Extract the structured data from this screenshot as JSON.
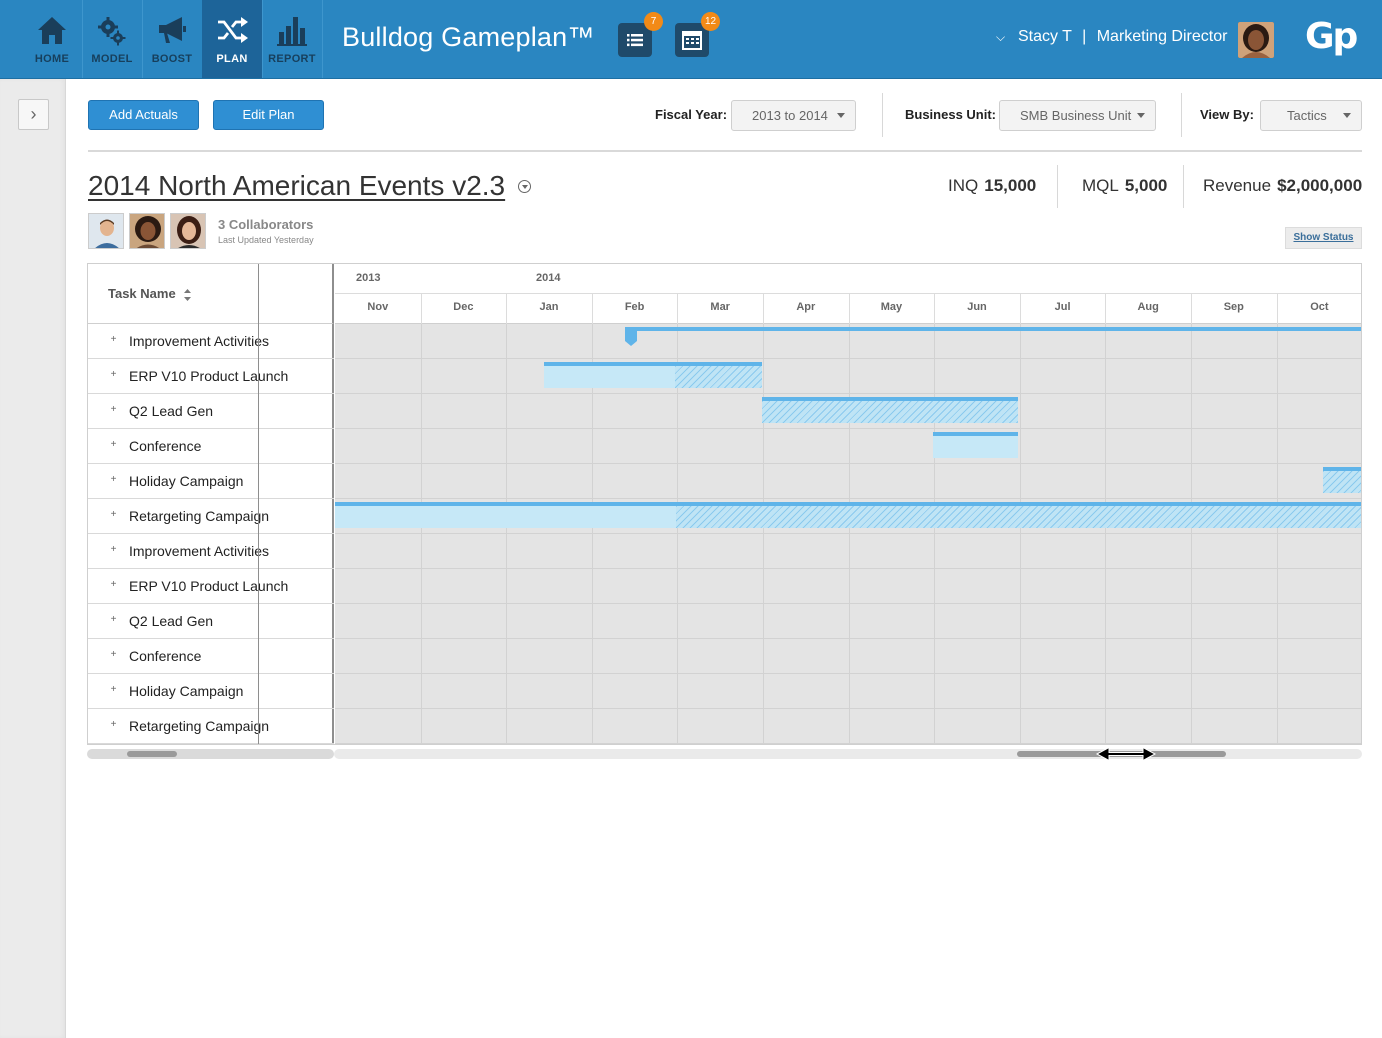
{
  "nav": {
    "items": [
      {
        "label": "HOME",
        "icon": "home-icon"
      },
      {
        "label": "MODEL",
        "icon": "gears-icon"
      },
      {
        "label": "BOOST",
        "icon": "megaphone-icon"
      },
      {
        "label": "PLAN",
        "icon": "shuffle-icon",
        "active": true
      },
      {
        "label": "REPORT",
        "icon": "bar-chart-icon"
      }
    ]
  },
  "header": {
    "app_title": "Bulldog Gameplan™",
    "list_badge": "7",
    "calendar_badge": "12",
    "user_name": "Stacy T",
    "user_separator": "|",
    "user_role": "Marketing Director",
    "logo_text": "Gp"
  },
  "toolbar": {
    "add_actuals": "Add Actuals",
    "edit_plan": "Edit Plan",
    "fiscal_year_label": "Fiscal Year:",
    "fiscal_year_value": "2013 to 2014",
    "business_unit_label": "Business Unit:",
    "business_unit_value": "SMB Business Unit",
    "view_by_label": "View By:",
    "view_by_value": "Tactics"
  },
  "plan": {
    "title": "2014 North American Events v2.3",
    "metrics": {
      "inq_label": "INQ",
      "inq_value": "15,000",
      "mql_label": "MQL",
      "mql_value": "5,000",
      "revenue_label": "Revenue",
      "revenue_value": "$2,000,000"
    },
    "collaborators_count": "3 Collaborators",
    "last_updated": "Last Updated Yesterday",
    "show_status": "Show Status"
  },
  "gantt": {
    "task_column_label": "Task Name",
    "years": [
      "2013",
      "2014"
    ],
    "months": [
      "Nov",
      "Dec",
      "Jan",
      "Feb",
      "Mar",
      "Apr",
      "May",
      "Jun",
      "Jul",
      "Aug",
      "Sep",
      "Oct"
    ],
    "tasks": [
      {
        "name": "Improvement Activities"
      },
      {
        "name": "ERP V10 Product Launch"
      },
      {
        "name": "Q2 Lead Gen"
      },
      {
        "name": "Conference"
      },
      {
        "name": "Holiday Campaign"
      },
      {
        "name": "Retargeting Campaign"
      },
      {
        "name": "Improvement Activities"
      },
      {
        "name": "ERP V10 Product Launch"
      },
      {
        "name": "Q2 Lead Gen"
      },
      {
        "name": "Conference"
      },
      {
        "name": "Holiday Campaign"
      },
      {
        "name": "Retargeting Campaign"
      }
    ]
  },
  "colors": {
    "nav_blue": "#2a86c1",
    "nav_active": "#1d6499",
    "bar_blue": "#5fb4e9",
    "bar_light": "#c6e8f7",
    "badge_orange": "#f28a17"
  }
}
